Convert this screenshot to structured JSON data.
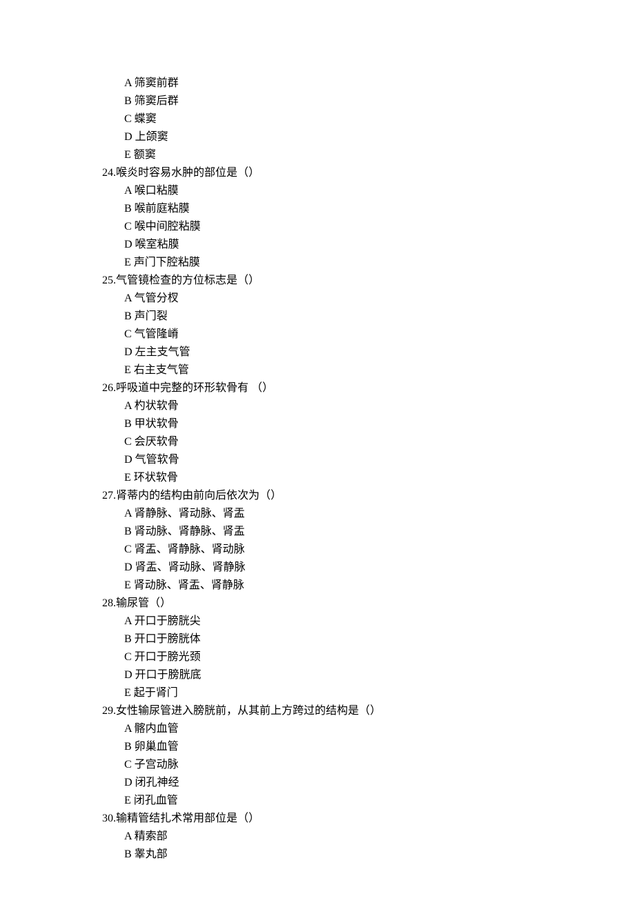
{
  "orphan_options": [
    "A 筛窦前群",
    "B 筛窦后群",
    "C 蝶窦",
    "D 上颌窦",
    "E 额窦"
  ],
  "questions": [
    {
      "number": "24",
      "stem": "24.喉炎时容易水肿的部位是（）",
      "options": [
        "A 喉口粘膜",
        "B 喉前庭粘膜",
        "C 喉中间腔粘膜",
        "D 喉室粘膜",
        "E 声门下腔粘膜"
      ]
    },
    {
      "number": "25",
      "stem": "25.气管镜检查的方位标志是（）",
      "options": [
        "A 气管分杈",
        "B 声门裂",
        "C 气管隆嵴",
        "D 左主支气管",
        "E 右主支气管"
      ]
    },
    {
      "number": "26",
      "stem": "26.呼吸道中完整的环形软骨有 （）",
      "options": [
        "A 杓状软骨",
        "B 甲状软骨",
        "C 会厌软骨",
        "D 气管软骨",
        "E 环状软骨"
      ]
    },
    {
      "number": "27",
      "stem": "27.肾蒂内的结构由前向后依次为（）",
      "options": [
        "A 肾静脉、肾动脉、肾盂",
        "B 肾动脉、肾静脉、肾盂",
        "C 肾盂、肾静脉、肾动脉",
        "D 肾盂、肾动脉、肾静脉",
        "E 肾动脉、肾盂、肾静脉"
      ]
    },
    {
      "number": "28",
      "stem": "28.输尿管（）",
      "options": [
        "A 开口于膀胱尖",
        "B 开口于膀胱体",
        "C 开口于膀光颈",
        "D 开口于膀胱底",
        "E 起于肾门"
      ]
    },
    {
      "number": "29",
      "stem": "29.女性输尿管进入膀胱前，从其前上方跨过的结构是（）",
      "options": [
        "A 髂内血管",
        "B 卵巢血管",
        "C 子宫动脉",
        "D 闭孔神经",
        "E 闭孔血管"
      ]
    },
    {
      "number": "30",
      "stem": "30.输精管结扎术常用部位是（）",
      "options": [
        "A 精索部",
        "B 睾丸部"
      ]
    }
  ]
}
